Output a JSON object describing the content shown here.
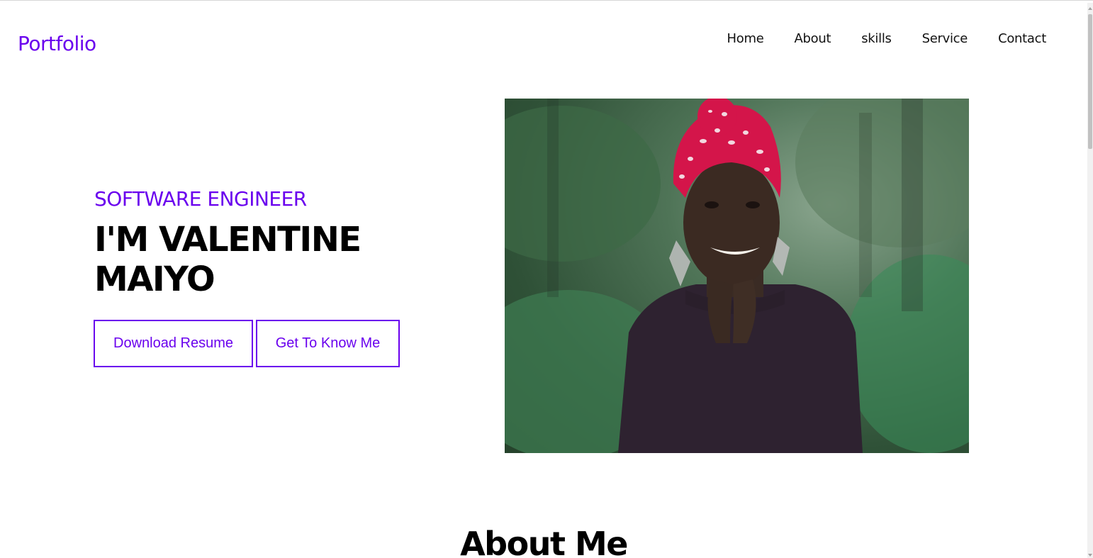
{
  "brand": "Portfolio",
  "nav": {
    "items": [
      "Home",
      "About",
      "skills",
      "Service",
      "Contact"
    ]
  },
  "hero": {
    "subtitle": "SOFTWARE ENGINEER",
    "title_line1": "I'M VALENTINE",
    "title_line2": "MAIYO",
    "buttons": {
      "resume": "Download Resume",
      "know": "Get To Know Me"
    }
  },
  "about": {
    "title": "About Me"
  },
  "colors": {
    "accent": "#6a00ee"
  }
}
